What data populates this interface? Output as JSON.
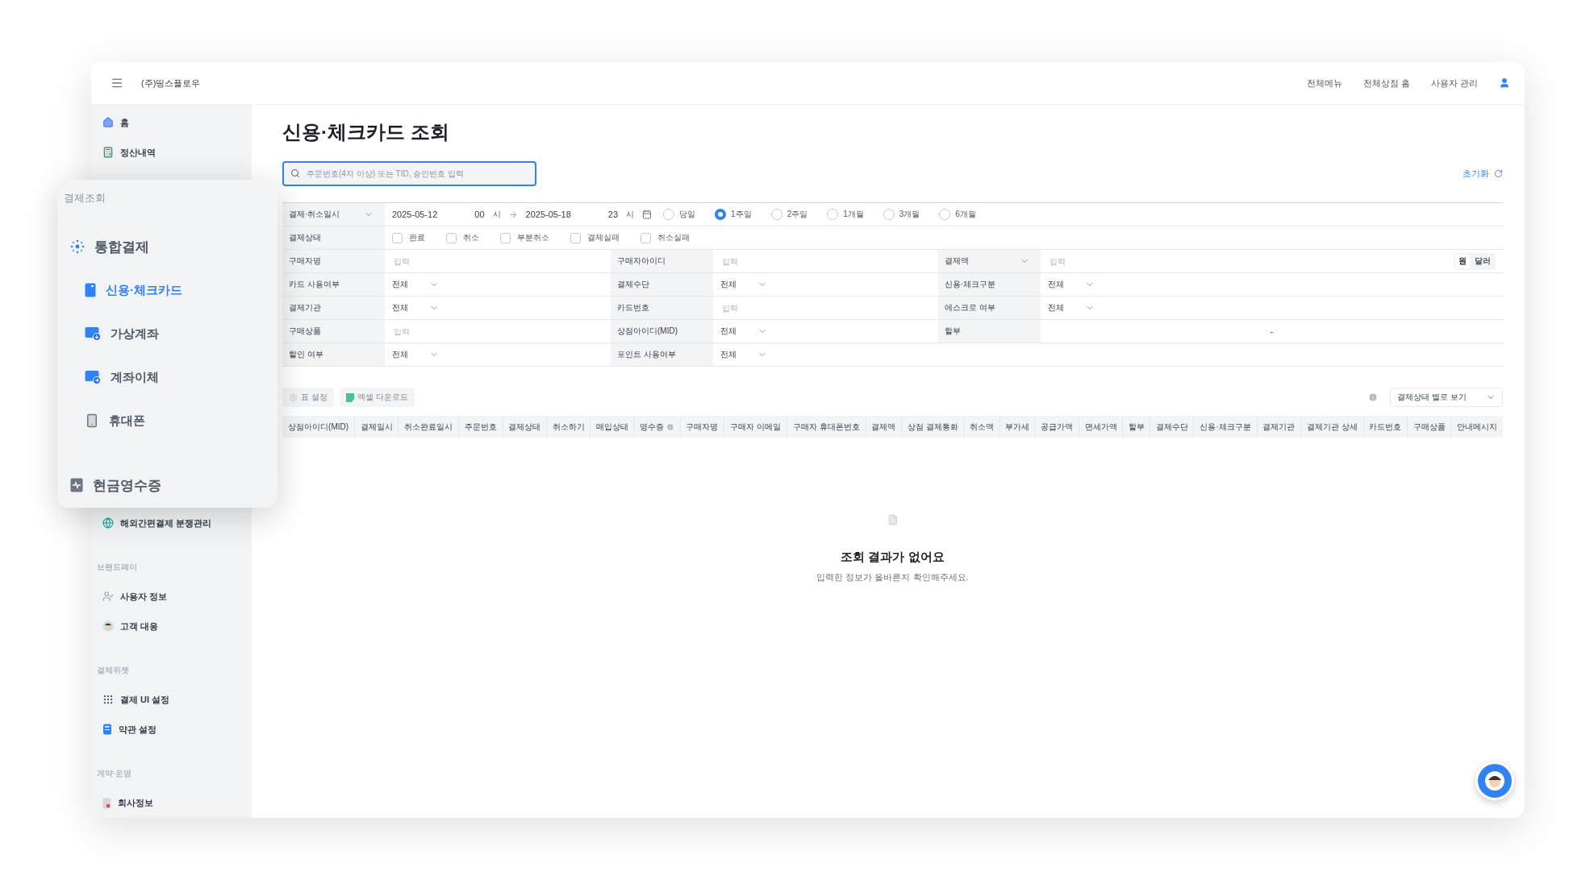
{
  "header": {
    "company": "(주)띵스플로우",
    "links": [
      "전체메뉴",
      "전체상점 홈",
      "사용자 관리"
    ]
  },
  "sidebar": {
    "items": [
      {
        "kind": "link",
        "label": "홈"
      },
      {
        "kind": "link",
        "label": "정산내역"
      },
      {
        "kind": "link",
        "label": "해외간편결제 분쟁관리"
      },
      {
        "kind": "section",
        "label": "브랜드페이"
      },
      {
        "kind": "link",
        "label": "사용자 정보"
      },
      {
        "kind": "link",
        "label": "고객 대응"
      },
      {
        "kind": "section",
        "label": "결제위젯"
      },
      {
        "kind": "link",
        "label": "결제 UI 설정"
      },
      {
        "kind": "link",
        "label": "약관 설정"
      },
      {
        "kind": "section",
        "label": "계약·운영"
      },
      {
        "kind": "link",
        "label": "회사정보"
      }
    ]
  },
  "menu_popup": {
    "section": "결제조회",
    "items": [
      {
        "label": "통합결제",
        "selected": false,
        "children": [
          {
            "label": "신용·체크카드",
            "selected": true
          },
          {
            "label": "가상계좌",
            "selected": false
          },
          {
            "label": "계좌이체",
            "selected": false
          },
          {
            "label": "휴대폰",
            "selected": false
          }
        ]
      },
      {
        "label": "현금영수증",
        "selected": false
      }
    ]
  },
  "page": {
    "title": "신용·체크카드 조회",
    "search": {
      "placeholder": "주문번호(4자 이상) 또는 TID, 승인번호 입력"
    },
    "reset": "초기화"
  },
  "period": {
    "label": "결제·취소일시",
    "start": {
      "date": "2025-05-12",
      "hour": "00",
      "unit": "시"
    },
    "end": {
      "date": "2025-05-18",
      "hour": "23",
      "unit": "시"
    },
    "presets": [
      {
        "label": "당일",
        "selected": false
      },
      {
        "label": "1주일",
        "selected": true
      },
      {
        "label": "2주일",
        "selected": false
      },
      {
        "label": "1개월",
        "selected": false
      },
      {
        "label": "3개월",
        "selected": false
      },
      {
        "label": "6개월",
        "selected": false
      }
    ]
  },
  "status": {
    "label": "결제상태",
    "options": [
      {
        "label": "완료",
        "checked": false
      },
      {
        "label": "취소",
        "checked": false
      },
      {
        "label": "부분취소",
        "checked": false
      },
      {
        "label": "결제실패",
        "checked": false
      },
      {
        "label": "취소실패",
        "checked": false
      }
    ]
  },
  "fields": [
    [
      {
        "label": "구매자명",
        "kind": "input",
        "placeholder": "입력"
      },
      {
        "label": "구매자아이디",
        "kind": "input",
        "placeholder": "입력"
      },
      {
        "label": "결제액",
        "label_menu": true,
        "kind": "input",
        "placeholder": "입력",
        "currency": [
          {
            "label": "원",
            "selected": true
          },
          {
            "label": "달러",
            "selected": false
          }
        ]
      }
    ],
    [
      {
        "label": "카드 사용여부",
        "kind": "select",
        "value": "전체"
      },
      {
        "label": "결제수단",
        "kind": "select",
        "value": "전체"
      },
      {
        "label": "신용·체크구분",
        "kind": "select",
        "value": "전체"
      }
    ],
    [
      {
        "label": "결제기관",
        "kind": "select",
        "value": "전체"
      },
      {
        "label": "카드번호",
        "kind": "input",
        "placeholder": "입력"
      },
      {
        "label": "에스크로 여부",
        "kind": "select",
        "value": "전체"
      }
    ],
    [
      {
        "label": "구매상품",
        "kind": "input",
        "placeholder": "입력"
      },
      {
        "label": "상점아이디(MID)",
        "kind": "select",
        "value": "전체"
      },
      {
        "label": "할부",
        "kind": "text",
        "value": "-"
      }
    ],
    [
      {
        "label": "할인 여부",
        "kind": "select",
        "value": "전체"
      },
      {
        "label": "포인트 사용여부",
        "kind": "select",
        "value": "전체"
      }
    ]
  ],
  "toolbar": {
    "buttons": [
      {
        "label": "표 설정",
        "disabled": true
      },
      {
        "label": "엑셀 다운로드",
        "disabled": true
      }
    ],
    "view_select": "결제상태 별로 보기"
  },
  "table": {
    "columns": [
      {
        "label": "상점아이디(MID)"
      },
      {
        "label": "결제일시"
      },
      {
        "label": "취소완료일시"
      },
      {
        "label": "주문번호"
      },
      {
        "label": "결제상태"
      },
      {
        "label": "취소하기"
      },
      {
        "label": "매입상태"
      },
      {
        "label": "영수증",
        "has_info": true
      },
      {
        "label": "구매자명"
      },
      {
        "label": "구매자 이메일"
      },
      {
        "label": "구매자 휴대폰번호"
      },
      {
        "label": "결제액"
      },
      {
        "label": "상점 결제통화"
      },
      {
        "label": "취소액"
      },
      {
        "label": "부가세"
      },
      {
        "label": "공급가액"
      },
      {
        "label": "면세가액"
      },
      {
        "label": "할부"
      },
      {
        "label": "결제수단"
      },
      {
        "label": "신용·체크구분"
      },
      {
        "label": "결제기관"
      },
      {
        "label": "결제기관 상세"
      },
      {
        "label": "카드번호"
      },
      {
        "label": "구매상품"
      },
      {
        "label": "안내메시지"
      }
    ],
    "empty": {
      "title": "조회 결과가 없어요",
      "message": "입력한 정보가 올바른지 확인해주세요."
    }
  }
}
